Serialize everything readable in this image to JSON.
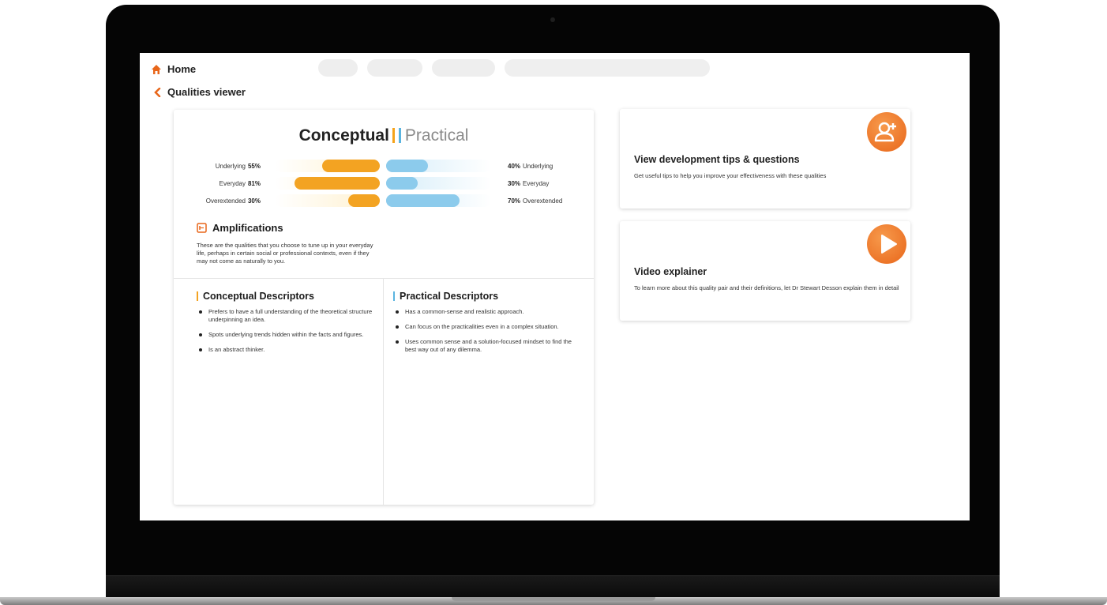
{
  "nav": {
    "home_label": "Home",
    "back_label": "Qualities viewer",
    "accent": "#e8661a"
  },
  "comparison": {
    "left_title": "Conceptual",
    "right_title": "Practical",
    "left_color": "#f3a322",
    "right_color": "#8ccbec",
    "rows": [
      {
        "name": "Underlying",
        "left_pct": 55,
        "left_value": "55%",
        "right_pct": 40,
        "right_value": "40%"
      },
      {
        "name": "Everyday",
        "left_pct": 81,
        "left_value": "81%",
        "right_pct": 30,
        "right_value": "30%"
      },
      {
        "name": "Overextended",
        "left_pct": 30,
        "left_value": "30%",
        "right_pct": 70,
        "right_value": "70%"
      }
    ]
  },
  "amplifications": {
    "title": "Amplifications",
    "text": "These are the qualities that you choose to tune up in your everyday life, perhaps in certain social or professional contexts, even if they may not come as naturally to you.",
    "icon": "document-icon"
  },
  "conceptual_descriptors": {
    "title": "Conceptual Descriptors",
    "items": [
      "Prefers to have a full understanding of the theoretical structure underpinning an idea.",
      "Spots underlying trends hidden within the facts and figures.",
      "Is an abstract thinker."
    ]
  },
  "practical_descriptors": {
    "title": "Practical Descriptors",
    "items": [
      "Has a common-sense and realistic approach.",
      "Can focus on the practicalities even in a complex situation.",
      "Uses common sense and a solution-focused mindset to find the best way out of any dilemma."
    ]
  },
  "tips_card": {
    "title": "View development tips & questions",
    "text": "Get useful tips to help you improve your effectiveness with these qualities",
    "icon": "user-add-icon"
  },
  "video_card": {
    "title": "Video explainer",
    "text": "To learn more about this quality pair and their definitions, let Dr Stewart Desson explain them in detail",
    "icon": "play-icon"
  }
}
